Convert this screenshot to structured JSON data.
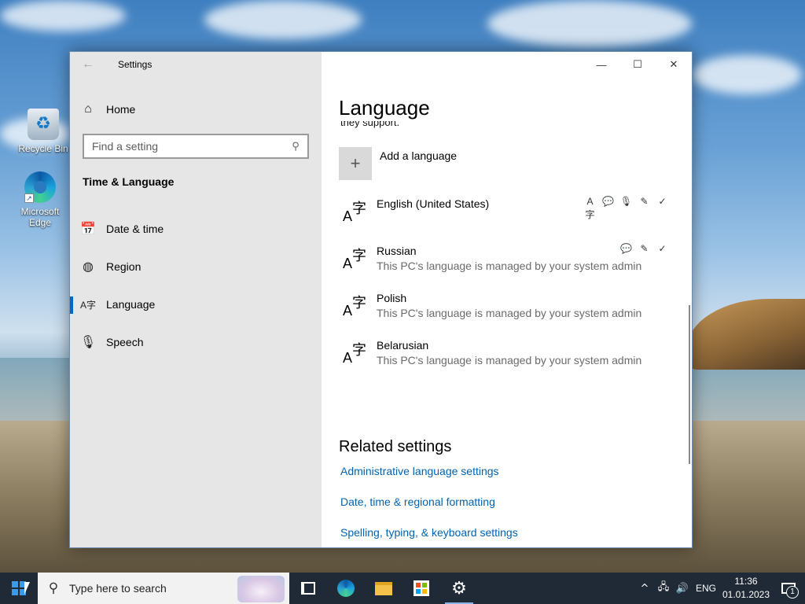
{
  "desktop": {
    "icons": [
      {
        "label": "Recycle Bin"
      },
      {
        "label": "Microsoft Edge"
      }
    ]
  },
  "window": {
    "title": "Settings",
    "controls": {
      "minimize": "—",
      "maximize": "☐",
      "close": "✕"
    }
  },
  "sidebar": {
    "home_label": "Home",
    "search_placeholder": "Find a setting",
    "section_title": "Time & Language",
    "items": [
      {
        "label": "Date & time",
        "icon": "calendar-clock-icon",
        "active": false
      },
      {
        "label": "Region",
        "icon": "globe-icon",
        "active": false
      },
      {
        "label": "Language",
        "icon": "language-icon",
        "active": true
      },
      {
        "label": "Speech",
        "icon": "microphone-icon",
        "active": false
      }
    ]
  },
  "main": {
    "page_title": "Language",
    "cut_text": "they support.",
    "add_language_label": "Add a language",
    "languages": [
      {
        "name": "English (United States)",
        "subtitle": "",
        "features": [
          "display-language-icon",
          "text-to-speech-icon",
          "speech-recognition-icon",
          "handwriting-icon",
          "spell-check-icon"
        ]
      },
      {
        "name": "Russian",
        "subtitle": "This PC's language is managed by your system admin",
        "features": [
          "text-to-speech-icon",
          "handwriting-icon",
          "spell-check-icon"
        ]
      },
      {
        "name": "Polish",
        "subtitle": "This PC's language is managed by your system admin",
        "features": []
      },
      {
        "name": "Belarusian",
        "subtitle": "This PC's language is managed by your system admin",
        "features": []
      }
    ],
    "related": {
      "title": "Related settings",
      "links": [
        "Administrative language settings",
        "Date, time & regional formatting",
        "Spelling, typing, & keyboard settings"
      ]
    }
  },
  "taskbar": {
    "search_placeholder": "Type here to search",
    "input_indicator": "ENG",
    "time": "11:36",
    "date": "01.01.2023",
    "notification_count": "1"
  },
  "colors": {
    "accent": "#0067c0",
    "link": "#0063b1",
    "sidebar_bg": "#e6e6e6",
    "taskbar_bg": "#1f2a36"
  }
}
